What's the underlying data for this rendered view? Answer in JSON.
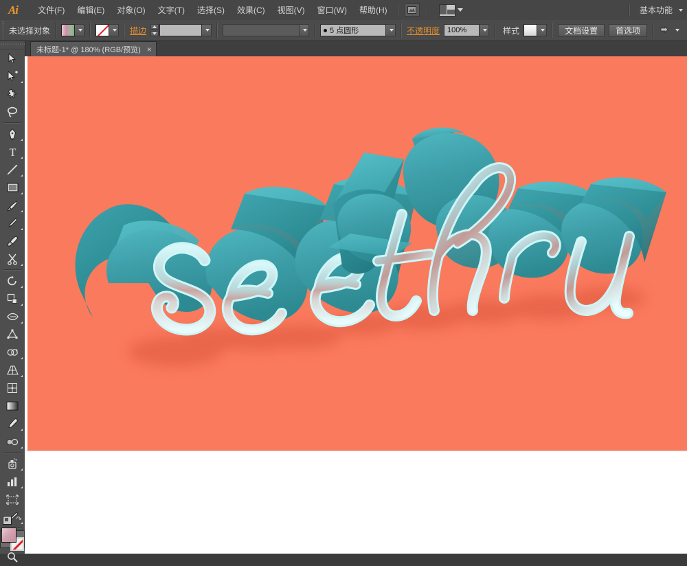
{
  "app": {
    "name": "Adobe Illustrator",
    "logo_text": "Ai"
  },
  "menubar": {
    "items": [
      {
        "label": "文件(F)",
        "name": "menu-file"
      },
      {
        "label": "编辑(E)",
        "name": "menu-edit"
      },
      {
        "label": "对象(O)",
        "name": "menu-object"
      },
      {
        "label": "文字(T)",
        "name": "menu-type"
      },
      {
        "label": "选择(S)",
        "name": "menu-select"
      },
      {
        "label": "效果(C)",
        "name": "menu-effect"
      },
      {
        "label": "视图(V)",
        "name": "menu-view"
      },
      {
        "label": "窗口(W)",
        "name": "menu-window"
      },
      {
        "label": "帮助(H)",
        "name": "menu-help"
      }
    ],
    "bridge_icon": "bridge-icon",
    "arrange_documents_icon": "arrange-documents-icon",
    "workspace_label": "基本功能",
    "workspace_caret_icon": "chevron-down-icon"
  },
  "controlbar": {
    "selection_status": "未选择对象",
    "fill_swatch_name": "fill-swatch",
    "stroke_swatch_name": "stroke-swatch-none",
    "stroke_label": "描边",
    "stroke_weight_value": "",
    "stroke_profile_value": "",
    "brush_definition_value": "5 点圆形",
    "opacity_label": "不透明度",
    "opacity_value": "100%",
    "style_label": "样式",
    "style_swatch_name": "graphic-style-swatch",
    "document_setup_label": "文档设置",
    "preferences_label": "首选项",
    "panel_menu_icon": "panel-options-icon"
  },
  "document": {
    "tab_title": "未标题-1* @ 180% (RGB/预览)",
    "close_icon": "close-icon",
    "zoom_level": "180%",
    "color_mode": "RGB",
    "view_mode": "预览",
    "modified": true
  },
  "toolbar": {
    "groups": [
      [
        {
          "name": "selection-tool",
          "icon": "arrow-cursor-icon",
          "has_flyout": false,
          "active": false
        },
        {
          "name": "direct-selection-tool",
          "icon": "white-arrow-plus-icon",
          "has_flyout": true,
          "active": false
        },
        {
          "name": "magic-wand-tool",
          "icon": "magic-wand-icon",
          "has_flyout": false,
          "active": false
        },
        {
          "name": "lasso-tool",
          "icon": "lasso-icon",
          "has_flyout": false,
          "active": false
        }
      ],
      [
        {
          "name": "pen-tool",
          "icon": "pen-nib-icon",
          "has_flyout": true,
          "active": false
        },
        {
          "name": "type-tool",
          "icon": "text-t-icon",
          "has_flyout": true,
          "active": false
        },
        {
          "name": "line-segment-tool",
          "icon": "diagonal-line-icon",
          "has_flyout": true,
          "active": false
        },
        {
          "name": "rectangle-tool",
          "icon": "rectangle-icon",
          "has_flyout": true,
          "active": false
        },
        {
          "name": "paintbrush-tool",
          "icon": "paintbrush-icon",
          "has_flyout": true,
          "active": false
        },
        {
          "name": "pencil-tool",
          "icon": "pencil-icon",
          "has_flyout": true,
          "active": false
        },
        {
          "name": "blob-brush-tool",
          "icon": "blob-brush-icon",
          "has_flyout": false,
          "active": false
        },
        {
          "name": "eraser-tool",
          "icon": "scissors-icon",
          "has_flyout": true,
          "active": false
        }
      ],
      [
        {
          "name": "rotate-tool",
          "icon": "rotate-icon",
          "has_flyout": true,
          "active": false
        },
        {
          "name": "scale-tool",
          "icon": "scale-icon",
          "has_flyout": true,
          "active": false
        },
        {
          "name": "width-tool",
          "icon": "width-warp-icon",
          "has_flyout": true,
          "active": false
        },
        {
          "name": "free-transform-tool",
          "icon": "free-transform-icon",
          "has_flyout": false,
          "active": false
        },
        {
          "name": "shape-builder-tool",
          "icon": "shape-builder-icon",
          "has_flyout": true,
          "active": false
        },
        {
          "name": "perspective-grid-tool",
          "icon": "perspective-grid-icon",
          "has_flyout": true,
          "active": false
        },
        {
          "name": "mesh-tool",
          "icon": "mesh-icon",
          "has_flyout": false,
          "active": false
        },
        {
          "name": "gradient-tool",
          "icon": "gradient-icon",
          "has_flyout": false,
          "active": false
        },
        {
          "name": "eyedropper-tool",
          "icon": "eyedropper-icon",
          "has_flyout": true,
          "active": false
        },
        {
          "name": "blend-tool",
          "icon": "blend-icon",
          "has_flyout": true,
          "active": false
        }
      ],
      [
        {
          "name": "symbol-sprayer-tool",
          "icon": "symbol-sprayer-icon",
          "has_flyout": true,
          "active": false
        },
        {
          "name": "column-graph-tool",
          "icon": "bar-graph-icon",
          "has_flyout": true,
          "active": false
        },
        {
          "name": "artboard-tool",
          "icon": "artboard-icon",
          "has_flyout": false,
          "active": false
        },
        {
          "name": "slice-tool",
          "icon": "slice-knife-icon",
          "has_flyout": true,
          "active": false
        }
      ],
      [
        {
          "name": "hand-tool",
          "icon": "hand-icon",
          "has_flyout": true,
          "active": true
        },
        {
          "name": "zoom-tool",
          "icon": "magnifier-icon",
          "has_flyout": false,
          "active": false
        }
      ]
    ],
    "fill_stroke": {
      "fill_name": "fill-color-swatch",
      "stroke_name": "stroke-color-swatch-none",
      "swap_icon": "swap-fill-stroke-icon",
      "default_icon": "default-fill-stroke-icon"
    }
  },
  "artwork": {
    "title": "see thru",
    "words": [
      "see",
      "thru"
    ],
    "background_color": "#fa7a5e",
    "letter_face_color": "#3d9fa8",
    "letter_top_color": "#45aab4",
    "extrude_color": "#2e8d93",
    "outline_color": "#c8f5f7",
    "shadow_color": "#e8684e",
    "style": "3D extruded script lettering with blurred shadow"
  }
}
